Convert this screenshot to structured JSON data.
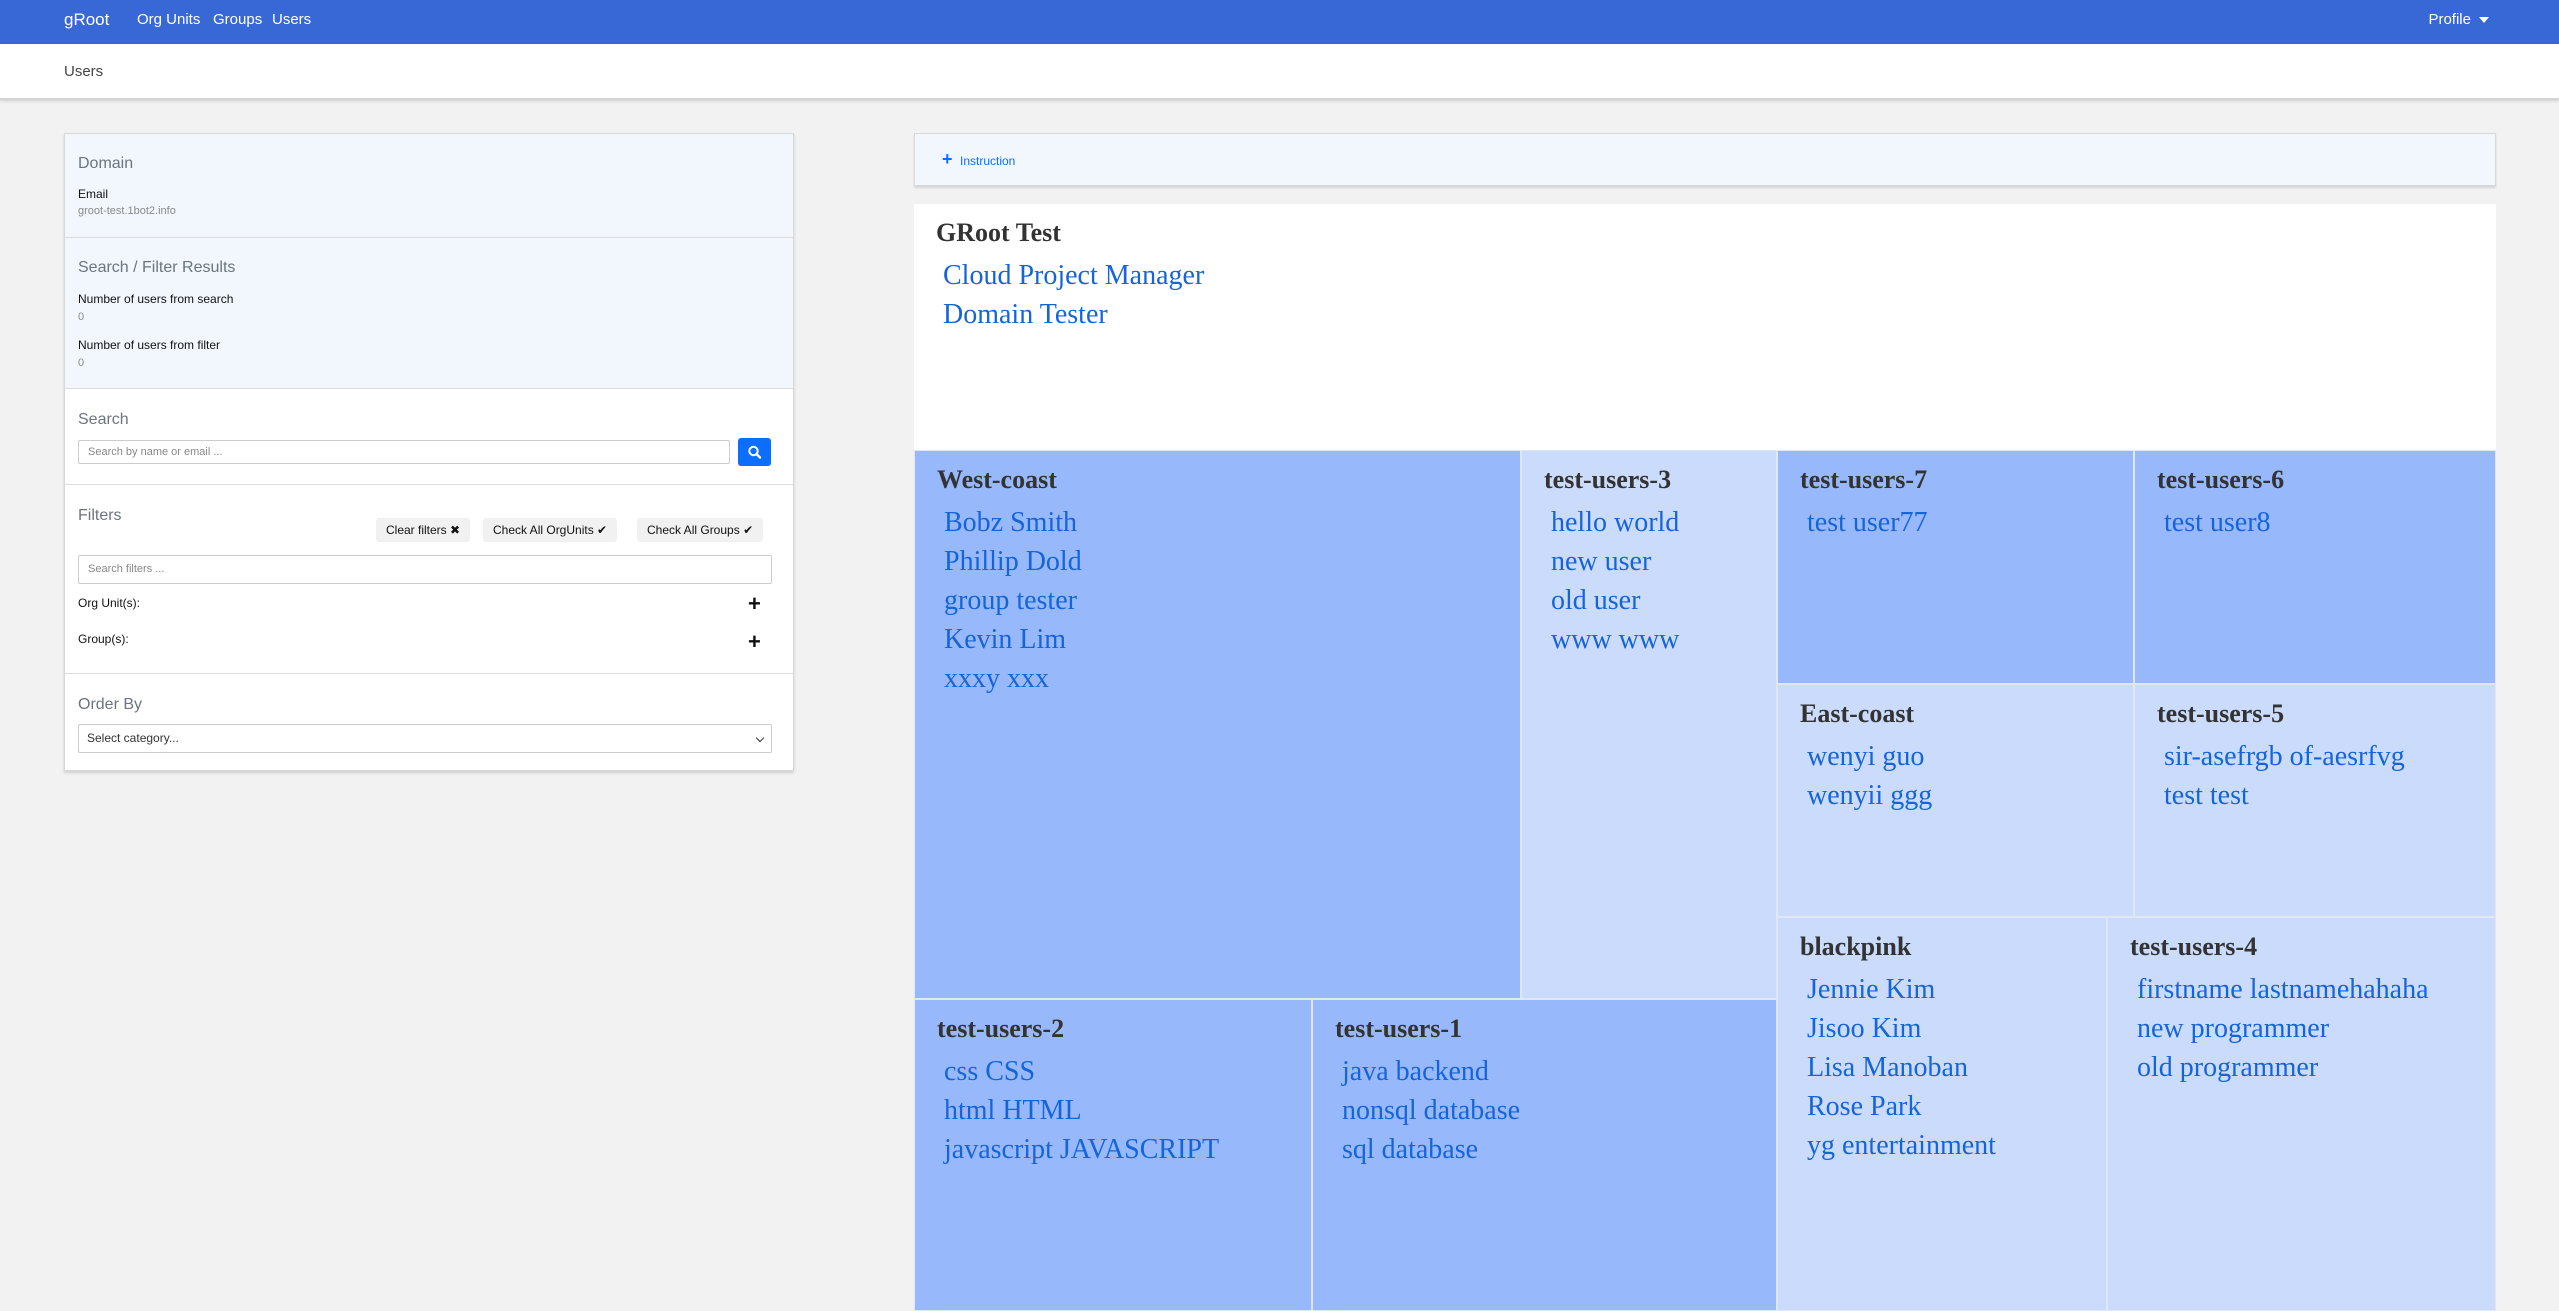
{
  "nav": {
    "brand": "gRoot",
    "links": [
      "Org Units",
      "Groups",
      "Users"
    ],
    "profile": "Profile"
  },
  "breadcrumb": "Users",
  "sidebar": {
    "domain": {
      "title": "Domain",
      "email_label": "Email",
      "email_value": "groot-test.1bot2.info"
    },
    "results": {
      "title": "Search / Filter Results",
      "search_label": "Number of users from search",
      "search_value": "0",
      "filter_label": "Number of users from filter",
      "filter_value": "0"
    },
    "search": {
      "title": "Search",
      "placeholder": "Search by name or email ..."
    },
    "filters": {
      "title": "Filters",
      "clear": "Clear filters",
      "check_orgunits": "Check All OrgUnits",
      "check_groups": "Check All Groups",
      "placeholder": "Search filters ...",
      "orgunits_label": "Org Unit(s):",
      "groups_label": "Group(s):"
    },
    "order": {
      "title": "Order By",
      "selected": "Select category..."
    }
  },
  "instruction": "Instruction",
  "treemap": {
    "root": {
      "title": "GRoot Test",
      "members": [
        "Cloud Project Manager",
        "Domain Tester"
      ]
    },
    "groups": [
      {
        "name": "West-coast",
        "members": [
          "Bobz Smith",
          "Phillip Dold",
          "group tester",
          "Kevin Lim",
          "xxxy xxx"
        ]
      },
      {
        "name": "test-users-3",
        "members": [
          "hello world",
          "new user",
          "old user",
          "www www"
        ]
      },
      {
        "name": "test-users-7",
        "members": [
          "test user77"
        ]
      },
      {
        "name": "test-users-6",
        "members": [
          "test user8"
        ]
      },
      {
        "name": "East-coast",
        "members": [
          "wenyi guo",
          "wenyii ggg"
        ]
      },
      {
        "name": "test-users-5",
        "members": [
          "sir-asefrgb of-aesrfvg",
          "test test"
        ]
      },
      {
        "name": "blackpink",
        "members": [
          "Jennie Kim",
          "Jisoo Kim",
          "Lisa Manoban",
          "Rose Park",
          "yg entertainment"
        ]
      },
      {
        "name": "test-users-4",
        "members": [
          "firstname lastnamehahaha",
          "new programmer",
          "old programmer"
        ]
      },
      {
        "name": "test-users-2",
        "members": [
          "css CSS",
          "html HTML",
          "javascript JAVASCRIPT"
        ]
      },
      {
        "name": "test-users-1",
        "members": [
          "java backend",
          "nonsql database",
          "sql database"
        ]
      }
    ]
  },
  "colors": {
    "navbar": "#3867d6",
    "dark_cell": "#97b8fa",
    "light_cell": "#cadbfb",
    "link": "#1565d8",
    "primary": "#0d6efd"
  }
}
